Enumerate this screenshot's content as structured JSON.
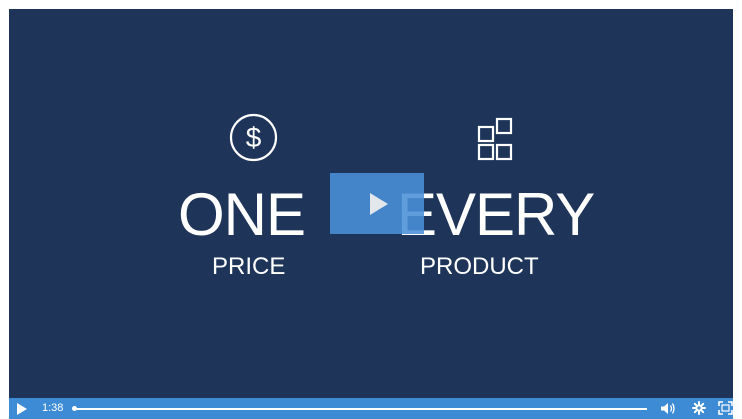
{
  "video": {
    "left_label": "ONE",
    "left_sub": "PRICE",
    "right_label": "EVERY",
    "right_sub": "PRODUCT",
    "icons": [
      "dollar-icon",
      "grid-icon"
    ],
    "background_color": "#1e3559",
    "overlay_color": "#4a90d9"
  },
  "controls": {
    "time": "1:38",
    "progress_fraction": 0.0,
    "bar_color": "#3d8bd4",
    "icons": [
      "play-icon",
      "volume-icon",
      "gear-icon",
      "fullscreen-icon"
    ]
  }
}
